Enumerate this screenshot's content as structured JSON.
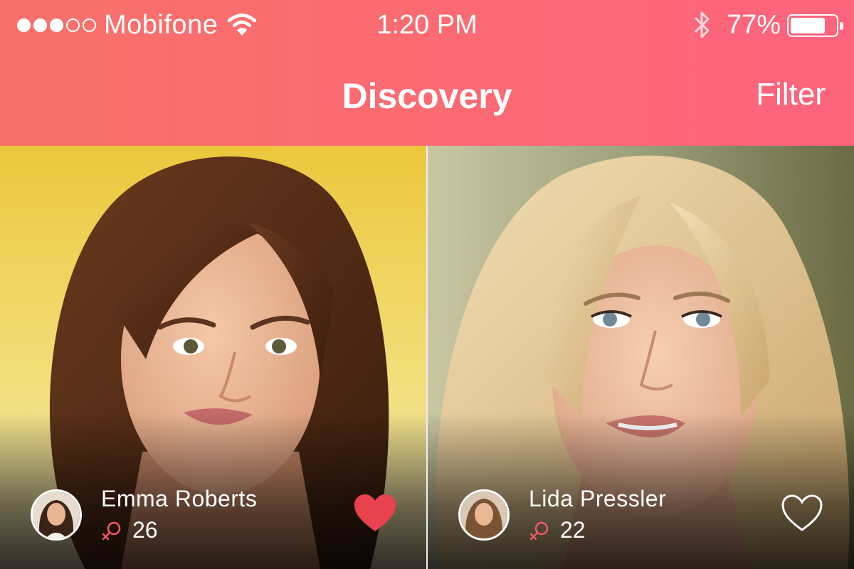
{
  "status_bar": {
    "signal_bars_filled": 3,
    "signal_bars_total": 5,
    "carrier": "Mobifone",
    "time": "1:20 PM",
    "battery_percent": "77%",
    "battery_level": 0.77,
    "icons": [
      "wifi-icon",
      "bluetooth-icon",
      "battery-icon"
    ]
  },
  "nav": {
    "title": "Discovery",
    "filter_label": "Filter"
  },
  "profiles": [
    {
      "name": "Emma Roberts",
      "age": "26",
      "liked": true,
      "gender_icon": "female-symbol-icon"
    },
    {
      "name": "Lida Pressler",
      "age": "22",
      "liked": false,
      "gender_icon": "female-symbol-icon"
    }
  ],
  "colors": {
    "header_gradient_start": "#f8716a",
    "header_gradient_end": "#fc647d",
    "accent_red": "#e8424f",
    "gender_icon": "#f25a63"
  }
}
